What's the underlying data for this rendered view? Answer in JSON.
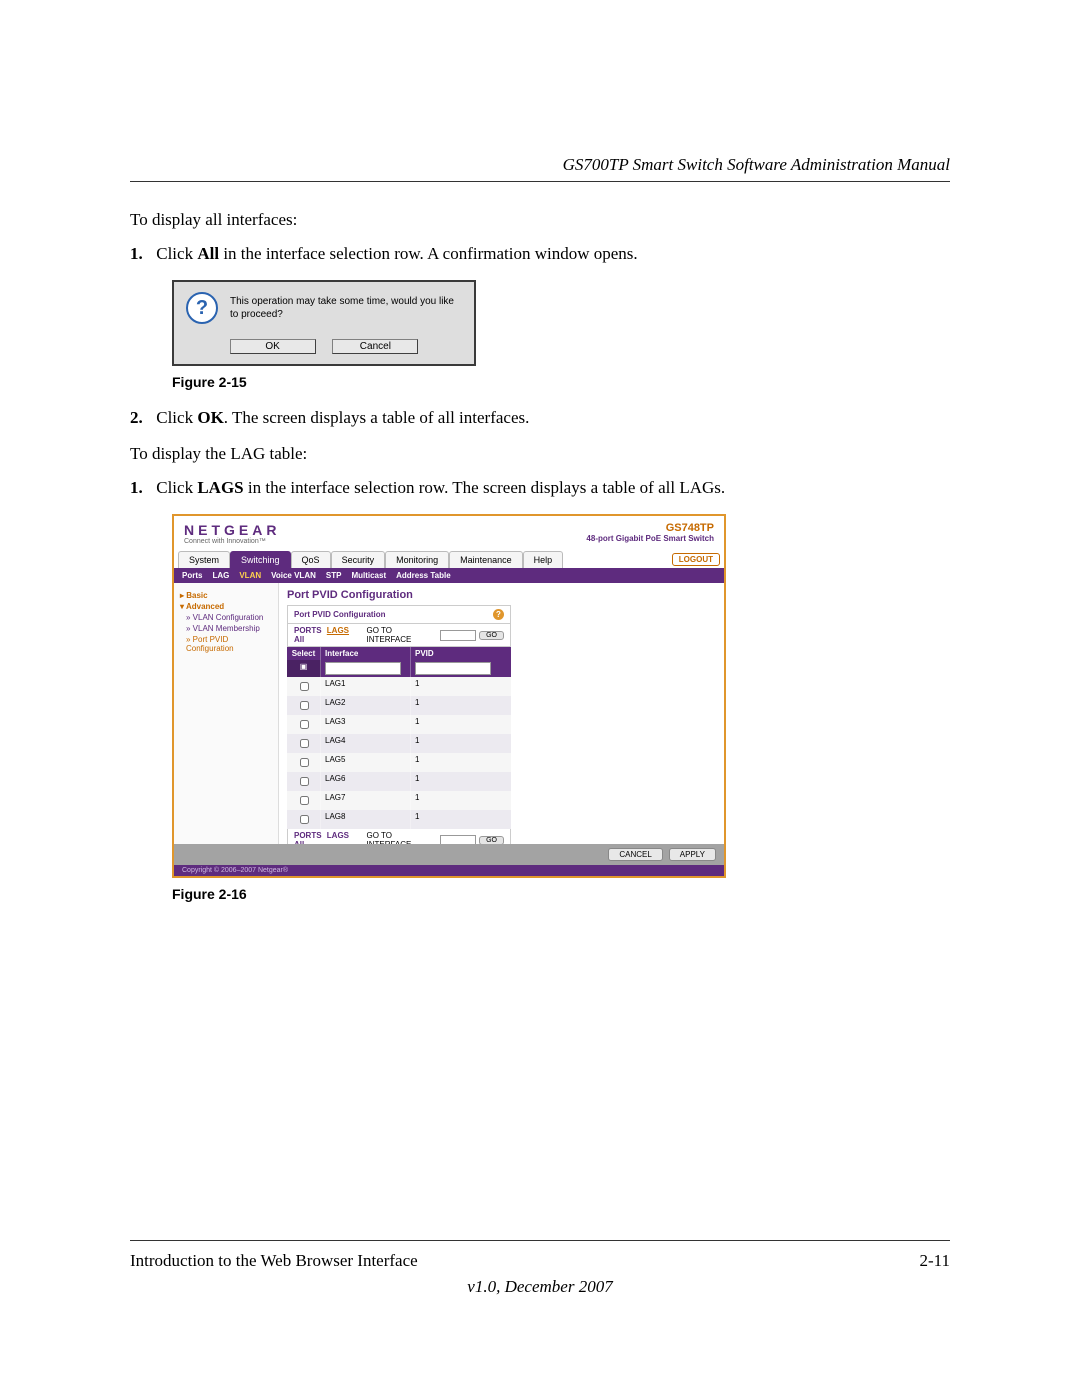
{
  "header": {
    "title": "GS700TP Smart Switch Software Administration Manual"
  },
  "body": {
    "intro1": "To display all interfaces:",
    "step1_num": "1.",
    "step1_pre": "Click ",
    "step1_bold": "All",
    "step1_post": " in the interface selection row. A confirmation window opens.",
    "fig15": "Figure 2-15",
    "step2_num": "2.",
    "step2_pre": "Click ",
    "step2_bold": "OK",
    "step2_post": ". The screen displays a table of all interfaces.",
    "intro2": "To display the LAG table:",
    "step3_num": "1.",
    "step3_pre": "Click ",
    "step3_bold": "LAGS",
    "step3_post": " in the interface selection row. The screen displays a table of all LAGs.",
    "fig16": "Figure 2-16"
  },
  "dialog": {
    "message": "This operation may take some time, would you like to proceed?",
    "ok": "OK",
    "cancel": "Cancel"
  },
  "ui": {
    "brand": "NETGEAR",
    "tagline": "Connect with Innovation™",
    "model": "GS748TP",
    "model_desc": "48-port Gigabit PoE Smart Switch",
    "tabs": [
      "System",
      "Switching",
      "QoS",
      "Security",
      "Monitoring",
      "Maintenance",
      "Help"
    ],
    "active_tab": "Switching",
    "logout": "LOGOUT",
    "subtabs": [
      "Ports",
      "LAG",
      "VLAN",
      "Voice VLAN",
      "STP",
      "Multicast",
      "Address Table"
    ],
    "active_subtab": "VLAN",
    "side": {
      "basic": "Basic",
      "advanced": "Advanced",
      "items": [
        "VLAN Configuration",
        "VLAN Membership",
        "Port PVID Configuration"
      ],
      "active_item": "Port PVID Configuration"
    },
    "panel_title": "Port PVID Configuration",
    "panel_header": "Port PVID Configuration",
    "selector": {
      "ports": "PORTS",
      "lags": "LAGS",
      "all": "All",
      "gti_label": "GO TO INTERFACE",
      "go": "GO"
    },
    "columns": {
      "select": "Select",
      "interface": "Interface",
      "pvid": "PVID"
    },
    "rows": [
      {
        "interface": "LAG1",
        "pvid": "1"
      },
      {
        "interface": "LAG2",
        "pvid": "1"
      },
      {
        "interface": "LAG3",
        "pvid": "1"
      },
      {
        "interface": "LAG4",
        "pvid": "1"
      },
      {
        "interface": "LAG5",
        "pvid": "1"
      },
      {
        "interface": "LAG6",
        "pvid": "1"
      },
      {
        "interface": "LAG7",
        "pvid": "1"
      },
      {
        "interface": "LAG8",
        "pvid": "1"
      }
    ],
    "buttons": {
      "cancel": "CANCEL",
      "apply": "APPLY"
    },
    "copyright": "Copyright © 2006–2007 Netgear®"
  },
  "footer": {
    "section": "Introduction to the Web Browser Interface",
    "page": "2-11",
    "version": "v1.0, December 2007"
  }
}
